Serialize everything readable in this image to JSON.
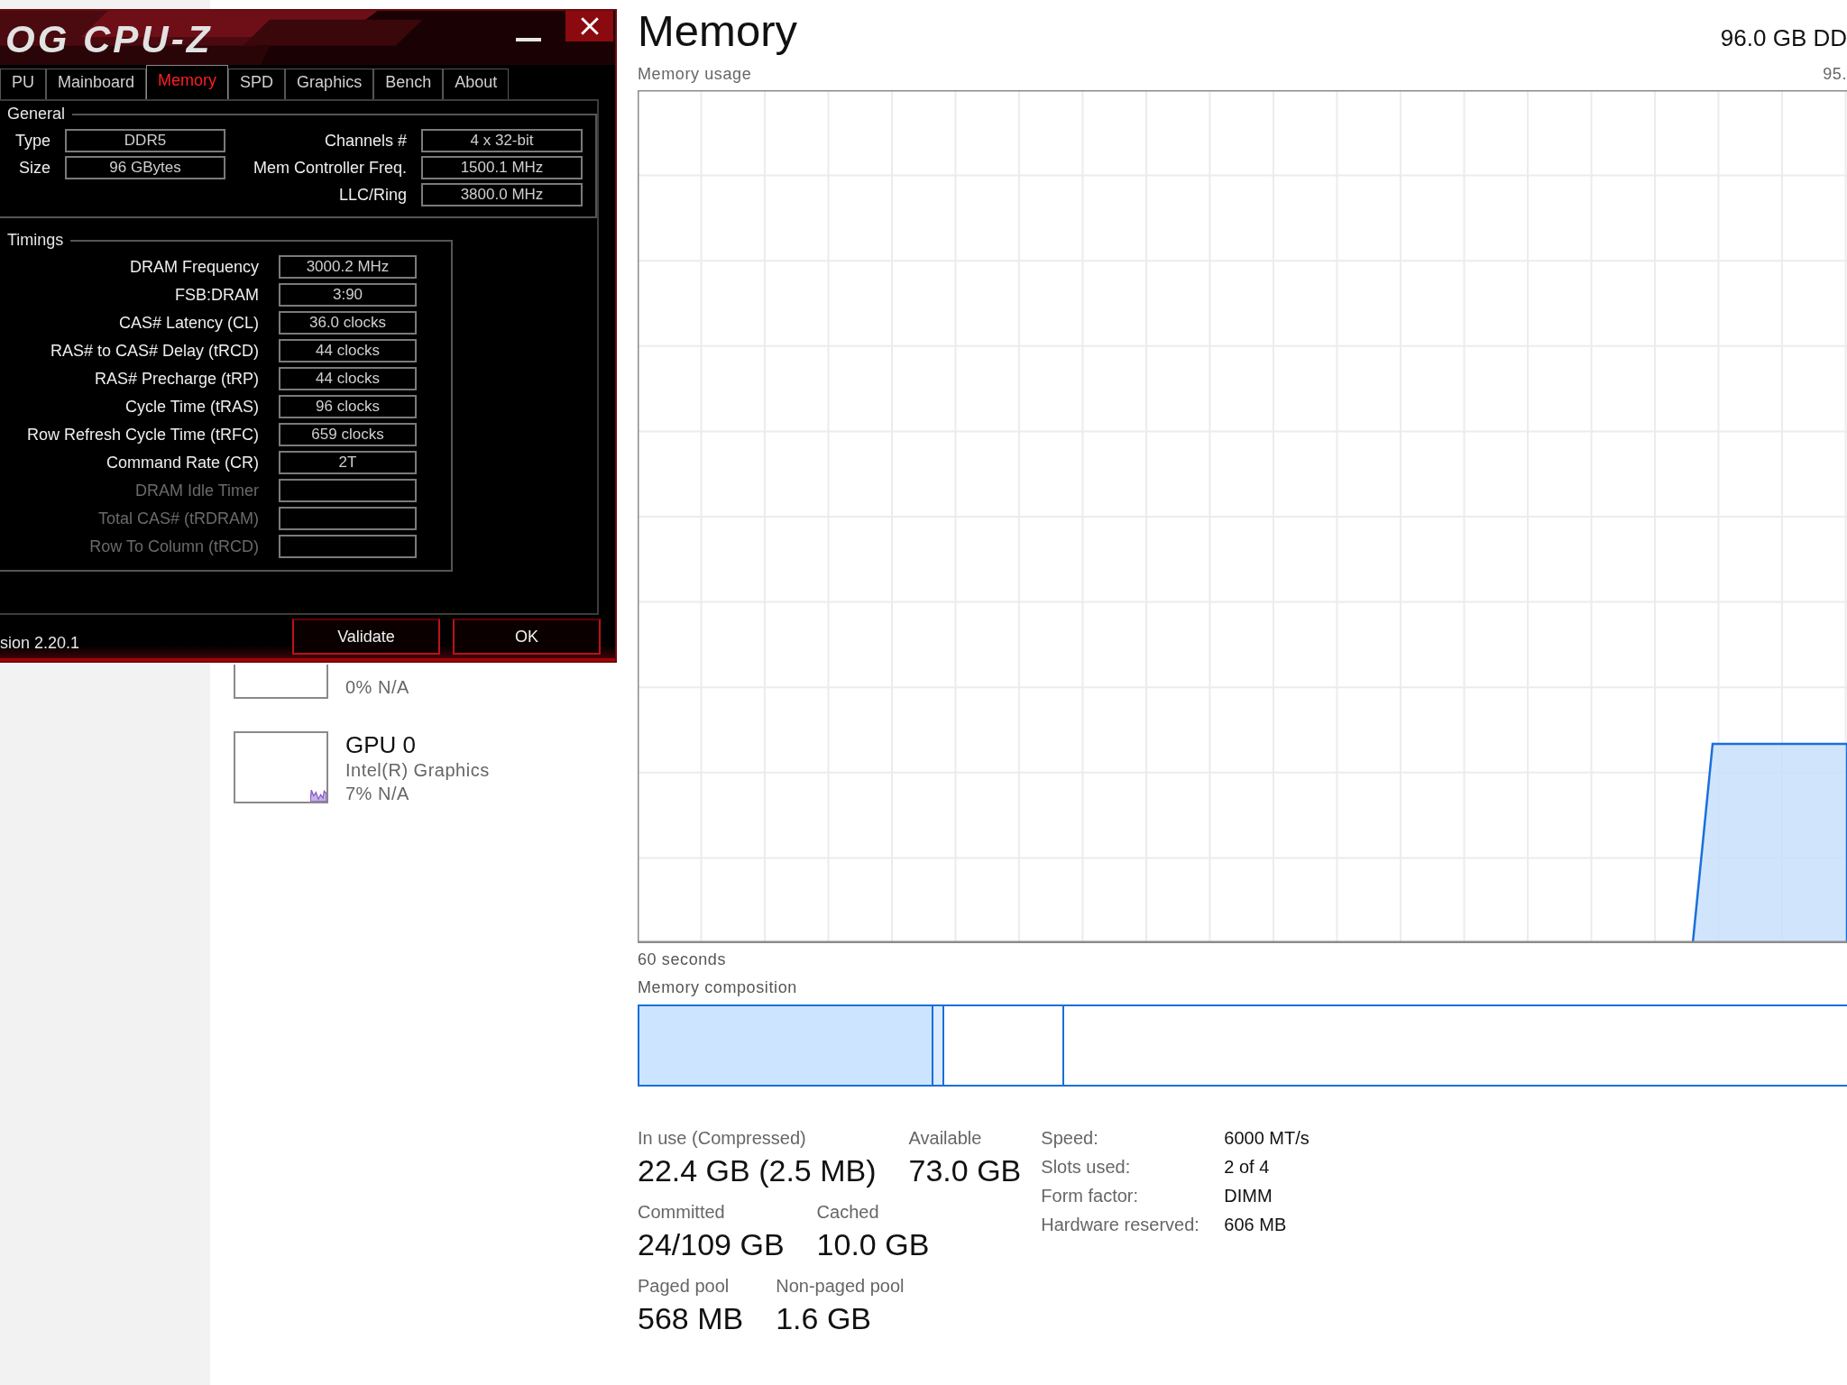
{
  "cpuz": {
    "logo": "OG CPU-Z",
    "tabs": [
      {
        "label": "PU",
        "selected": false
      },
      {
        "label": "Mainboard",
        "selected": false
      },
      {
        "label": "Memory",
        "selected": true
      },
      {
        "label": "SPD",
        "selected": false
      },
      {
        "label": "Graphics",
        "selected": false
      },
      {
        "label": "Bench",
        "selected": false
      },
      {
        "label": "About",
        "selected": false
      }
    ],
    "general": {
      "title": "General",
      "left_fields": [
        {
          "label": "Type",
          "value": "DDR5"
        },
        {
          "label": "Size",
          "value": "96 GBytes"
        }
      ],
      "right_fields": [
        {
          "label": "Channels #",
          "value": "4 x 32-bit"
        },
        {
          "label": "Mem Controller Freq.",
          "value": "1500.1 MHz"
        },
        {
          "label": "LLC/Ring",
          "value": "3800.0 MHz"
        }
      ]
    },
    "timings": {
      "title": "Timings",
      "rows": [
        {
          "label": "DRAM Frequency",
          "value": "3000.2 MHz",
          "disabled": false
        },
        {
          "label": "FSB:DRAM",
          "value": "3:90",
          "disabled": false
        },
        {
          "label": "CAS# Latency (CL)",
          "value": "36.0 clocks",
          "disabled": false
        },
        {
          "label": "RAS# to CAS# Delay (tRCD)",
          "value": "44 clocks",
          "disabled": false
        },
        {
          "label": "RAS# Precharge (tRP)",
          "value": "44 clocks",
          "disabled": false
        },
        {
          "label": "Cycle Time (tRAS)",
          "value": "96 clocks",
          "disabled": false
        },
        {
          "label": "Row Refresh Cycle Time (tRFC)",
          "value": "659 clocks",
          "disabled": false
        },
        {
          "label": "Command Rate (CR)",
          "value": "2T",
          "disabled": false
        },
        {
          "label": "DRAM Idle Timer",
          "disabled": true
        },
        {
          "label": "Total CAS# (tRDRAM)",
          "disabled": true
        },
        {
          "label": "Row To Column (tRCD)",
          "disabled": true
        }
      ]
    },
    "version": "sion 2.20.1",
    "buttons": [
      "Validate",
      "OK"
    ]
  },
  "sidebar": {
    "items": [
      {
        "usage": "0% N/A",
        "active": false
      },
      {
        "title": "GPU 0",
        "name": "Intel(R) Graphics",
        "usage": "7% N/A",
        "active": true
      }
    ]
  },
  "memory": {
    "title": "Memory",
    "capacity": "96.0 GB DD",
    "usage_label": "Memory usage",
    "usage_max": "95.",
    "time_label": "60 seconds",
    "composition_label": "Memory composition",
    "stats": [
      [
        {
          "label": "In use (Compressed)",
          "value": "22.4 GB (2.5 MB)"
        },
        {
          "label": "Available",
          "value": "73.0 GB"
        }
      ],
      [
        {
          "label": "Committed",
          "value": "24/109 GB"
        },
        {
          "label": "Cached",
          "value": "10.0 GB"
        }
      ],
      [
        {
          "label": "Paged pool",
          "value": "568 MB"
        },
        {
          "label": "Non-paged pool",
          "value": "1.6 GB"
        }
      ]
    ],
    "details": [
      {
        "label": "Speed:",
        "value": "6000 MT/s"
      },
      {
        "label": "Slots used:",
        "value": "2 of 4"
      },
      {
        "label": "Form factor:",
        "value": "DIMM"
      },
      {
        "label": "Hardware reserved:",
        "value": "606 MB"
      }
    ]
  }
}
